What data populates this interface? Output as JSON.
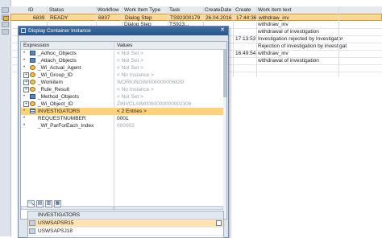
{
  "grid": {
    "columns": [
      "ID",
      "Status",
      "Workflow",
      "Work Item Type",
      "Task",
      "CreateDate",
      "Create",
      "Work item text"
    ],
    "rows": [
      {
        "id": "6839",
        "status": "READY",
        "workflow": "6837",
        "type": "Dialog Step",
        "task": "TS92300179",
        "date": "26.04.2016",
        "time": "17:44:36",
        "text": "withdraw_inv"
      },
      {
        "id": "",
        "status": "",
        "workflow": "",
        "type": "Dialog Step",
        "task": "TS923...",
        "date": "",
        "time": "",
        "text": "withdraw_inv"
      },
      {
        "id": "",
        "status": "",
        "workflow": "",
        "type": "",
        "task": "",
        "date": "",
        "time": "",
        "text": "withdrawal of investigation"
      },
      {
        "id": "",
        "status": "",
        "workflow": "",
        "type": "",
        "task": "",
        "date": "",
        "time": "17:13:53",
        "text": "Investigation rejected by Investigator"
      },
      {
        "id": "",
        "status": "",
        "workflow": "",
        "type": "",
        "task": "",
        "date": "",
        "time": "",
        "text": "Rejection of investigation by investigat"
      },
      {
        "id": "",
        "status": "",
        "workflow": "",
        "type": "",
        "task": "",
        "date": "",
        "time": "16:49:54",
        "text": "withdraw_inv"
      },
      {
        "id": "",
        "status": "",
        "workflow": "",
        "type": "",
        "task": "",
        "date": "",
        "time": "",
        "text": "withdrawal of investigation"
      }
    ]
  },
  "dialog": {
    "title": "Display Container Instance",
    "close_label": "✕",
    "col_expression": "Expression",
    "col_values": "Values",
    "nodes": [
      {
        "name": "_Adhoc_Objects",
        "value": "< Not Set >",
        "icon": "obj",
        "mark": "bullet"
      },
      {
        "name": "_Attach_Objects",
        "value": "< Not Set >",
        "icon": "obj",
        "mark": "bullet"
      },
      {
        "name": "_Wi_Actual_Agent",
        "value": "< Not Set >",
        "icon": "field",
        "mark": "bullet"
      },
      {
        "name": "_Wi_Group_ID",
        "value": "< No Instance >",
        "icon": "field",
        "mark": "expand"
      },
      {
        "name": "_Workitem",
        "value": "WORKINGWI000000006839",
        "icon": "field",
        "mark": "expand"
      },
      {
        "name": "_Rule_Result",
        "value": "< No Instance >",
        "icon": "field",
        "mark": "expand"
      },
      {
        "name": "_Method_Objects",
        "value": "< Not Set >",
        "icon": "obj",
        "mark": "bullet"
      },
      {
        "name": "_Wi_Object_ID",
        "value": "ZINVCLAIM0000000000002306",
        "icon": "field",
        "mark": "expand"
      },
      {
        "name": "INVESTIGATORS",
        "value": "< 2 Entries >",
        "icon": "table",
        "mark": "bullet",
        "highlight": true
      },
      {
        "name": "REQUESTNUMBER",
        "value": "0001",
        "icon": "none",
        "mark": "bullet",
        "dark": true
      },
      {
        "name": "_Wf_ParForEach_Index",
        "value": "000002",
        "icon": "none",
        "mark": "bullet"
      }
    ],
    "toolbar": [
      "🔍",
      "▤",
      "▥",
      "▦"
    ],
    "subtable": {
      "header": "INVESTIGATORS",
      "rows": [
        "USWSAPSR15",
        "USWSAPSJ18"
      ]
    }
  }
}
